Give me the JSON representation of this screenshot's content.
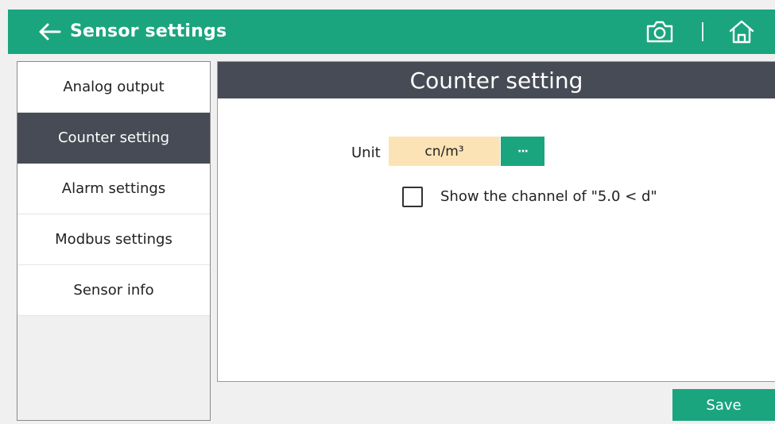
{
  "header": {
    "title": "Sensor settings",
    "back_icon": "arrow-left-icon",
    "camera_icon": "camera-icon",
    "home_icon": "home-icon",
    "background_color": "#1aa57e"
  },
  "sidebar": {
    "items": [
      {
        "label": "Analog output",
        "active": false
      },
      {
        "label": "Counter setting",
        "active": true
      },
      {
        "label": "Alarm settings",
        "active": false
      },
      {
        "label": "Modbus settings",
        "active": false
      },
      {
        "label": "Sensor info",
        "active": false
      }
    ],
    "active_color": "#474b55"
  },
  "main": {
    "title": "Counter setting",
    "unit": {
      "label": "Unit",
      "value": "cn/m³",
      "more_label": "···",
      "value_background": "#fbe3b5"
    },
    "checkbox": {
      "label": "Show the channel of \"5.0 < d\"",
      "checked": false
    }
  },
  "footer": {
    "save_label": "Save"
  }
}
